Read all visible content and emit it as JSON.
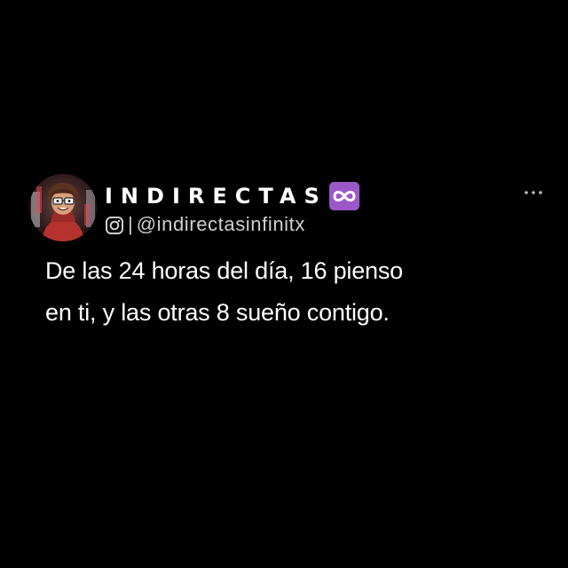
{
  "post": {
    "display_name": "INDIRECTAS",
    "name_badge_icon": "infinity-icon",
    "platform_icon": "instagram-icon",
    "separator": "|",
    "handle": "@indirectasinfinitx",
    "more_icon": "more-options-icon",
    "text_lines": [
      "De las 24 horas del día, 16 pienso",
      "en ti, y las otras 8 sueño contigo."
    ]
  },
  "colors": {
    "background": "#000000",
    "text": "#ffffff",
    "secondary_text": "#cfcfcf",
    "badge": "#9b59c8"
  }
}
